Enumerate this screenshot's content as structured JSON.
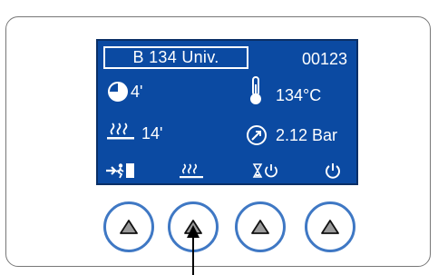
{
  "display": {
    "program_name": "B 134 Univ.",
    "counter": "00123",
    "time_value": "4'",
    "temperature": "134°C",
    "drying_time": "14'",
    "pressure": "2.12 Bar"
  },
  "icons": {
    "time": "pie-clock-icon",
    "temperature": "thermometer-icon",
    "drying": "steam-icon",
    "pressure": "gauge-icon",
    "soft_keys": [
      "exit-icon",
      "steam-icon",
      "timer-power-icon",
      "power-icon"
    ]
  },
  "colors": {
    "screen_bg": "#0b4aa2",
    "button_ring": "#3f78c4",
    "text": "#ffffff"
  }
}
